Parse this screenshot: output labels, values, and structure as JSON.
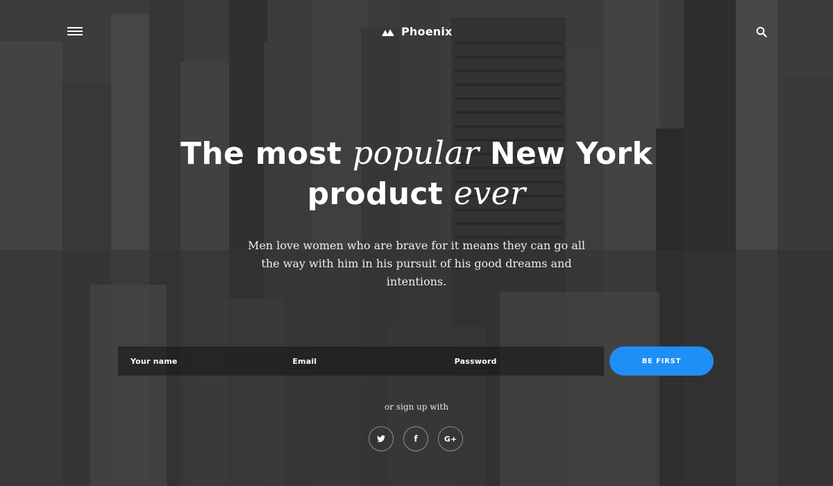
{
  "header": {
    "brand_name": "Phoenix",
    "menu_icon": "hamburger-icon",
    "search_icon": "search-icon",
    "logo_icon": "mountain-logo-icon"
  },
  "hero": {
    "headline_part1": "The most ",
    "headline_em1": "popular",
    "headline_part2": " New York",
    "headline_part3": "product ",
    "headline_em2": "ever",
    "subtext": "Men love women who are brave for it means they can go all the way with him in his pursuit of his good dreams and intentions."
  },
  "form": {
    "name_placeholder": "Your name",
    "email_placeholder": "Email",
    "password_placeholder": "Password",
    "submit_label": "BE FIRST"
  },
  "alt_signup": {
    "label": "or sign up with",
    "socials": [
      {
        "icon": "twitter-icon",
        "glyph": ""
      },
      {
        "icon": "facebook-icon",
        "glyph": "f"
      },
      {
        "icon": "google-plus-icon",
        "glyph": "G+"
      }
    ]
  },
  "colors": {
    "accent": "#1e8ff5",
    "overlay": "#141416"
  }
}
